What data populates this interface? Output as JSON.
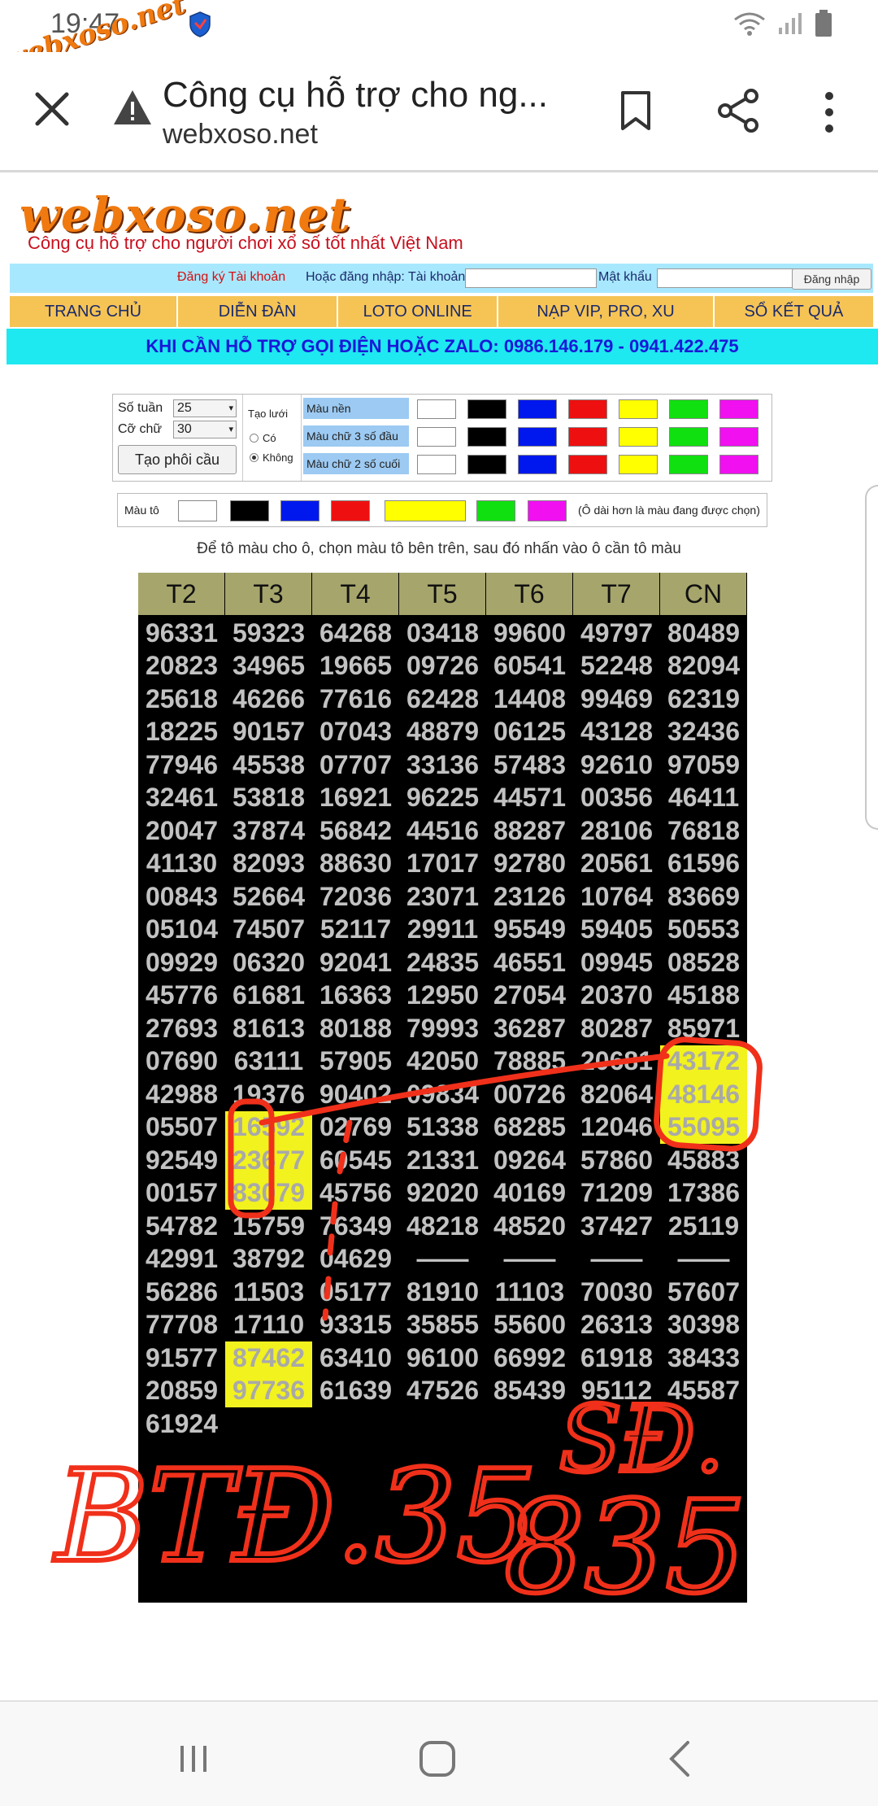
{
  "status_bar": {
    "time": "19:47",
    "watermark": "webxoso.net"
  },
  "browser": {
    "title": "Công cụ hỗ trợ cho ng...",
    "url": "webxoso.net"
  },
  "site": {
    "logo": "webxoso.net",
    "tagline": "Công cụ hỗ trợ cho người chơi xổ số tốt nhất Việt Nam"
  },
  "login": {
    "register": "Đăng ký Tài khoản",
    "or_login": "Hoặc đăng nhập: Tài khoản",
    "password_label": "Mật khẩu",
    "login_button": "Đăng nhập"
  },
  "nav": [
    "TRANG CHỦ",
    "DIỄN ĐÀN",
    "LOTO ONLINE",
    "NẠP VIP, PRO, XU",
    "SỔ KẾT QUẢ"
  ],
  "support": "KHI CẦN HỖ TRỢ GỌI ĐIỆN HOẶC ZALO: 0986.146.179 - 0941.422.475",
  "options": {
    "weeks_label": "Số tuần",
    "weeks_value": "25",
    "font_size_label": "Cỡ chữ",
    "font_size_value": "30",
    "generate_button": "Tạo phôi cầu",
    "grid_label": "Tạo lưới",
    "grid_yes": "Có",
    "grid_no": "Không",
    "bg_color_label": "Màu nền",
    "first3_color_label": "Màu chữ 3 số đầu",
    "last2_color_label": "Màu chữ 2 số cuối",
    "palette": [
      "#ffffff",
      "#000000",
      "#0018ee",
      "#ee1010",
      "#ffff00",
      "#10e010",
      "#f010f0"
    ]
  },
  "brush": {
    "label": "Màu tô",
    "note": "(Ô dài hơn là màu đang được chọn)"
  },
  "instruction": "Để tô màu cho ô, chọn màu tô bên trên, sau đó nhấn vào ô cần tô màu",
  "grid": {
    "headers": [
      "T2",
      "T3",
      "T4",
      "T5",
      "T6",
      "T7",
      "CN"
    ],
    "rows": [
      [
        "96331",
        "59323",
        "64268",
        "03418",
        "99600",
        "49797",
        "80489"
      ],
      [
        "20823",
        "34965",
        "19665",
        "09726",
        "60541",
        "52248",
        "82094"
      ],
      [
        "25618",
        "46266",
        "77616",
        "62428",
        "14408",
        "99469",
        "62319"
      ],
      [
        "18225",
        "90157",
        "07043",
        "48879",
        "06125",
        "43128",
        "32436"
      ],
      [
        "77946",
        "45538",
        "07707",
        "33136",
        "57483",
        "92610",
        "97059"
      ],
      [
        "32461",
        "53818",
        "16921",
        "96225",
        "44571",
        "00356",
        "46411"
      ],
      [
        "20047",
        "37874",
        "56842",
        "44516",
        "88287",
        "28106",
        "76818"
      ],
      [
        "41130",
        "82093",
        "88630",
        "17017",
        "92780",
        "20561",
        "61596"
      ],
      [
        "00843",
        "52664",
        "72036",
        "23071",
        "23126",
        "10764",
        "83669"
      ],
      [
        "05104",
        "74507",
        "52117",
        "29911",
        "95549",
        "59405",
        "50553"
      ],
      [
        "09929",
        "06320",
        "92041",
        "24835",
        "46551",
        "09945",
        "08528"
      ],
      [
        "45776",
        "61681",
        "16363",
        "12950",
        "27054",
        "20370",
        "45188"
      ],
      [
        "27693",
        "81613",
        "80188",
        "79993",
        "36287",
        "80287",
        "85971"
      ],
      [
        "07690",
        "63111",
        "57905",
        "42050",
        "78885",
        "20681",
        "43172"
      ],
      [
        "42988",
        "19376",
        "90402",
        "09834",
        "00726",
        "82064",
        "48146"
      ],
      [
        "05507",
        "16592",
        "02769",
        "51338",
        "68285",
        "12046",
        "55095"
      ],
      [
        "92549",
        "23677",
        "60545",
        "21331",
        "09264",
        "57860",
        "45883"
      ],
      [
        "00157",
        "83079",
        "45756",
        "92020",
        "40169",
        "71209",
        "17386"
      ],
      [
        "54782",
        "15759",
        "76349",
        "48218",
        "48520",
        "37427",
        "25119"
      ],
      [
        "42991",
        "38792",
        "04629",
        "——",
        "——",
        "——",
        "——"
      ],
      [
        "56286",
        "11503",
        "05177",
        "81910",
        "11103",
        "70030",
        "57607"
      ],
      [
        "77708",
        "17110",
        "93315",
        "35855",
        "55600",
        "26313",
        "30398"
      ],
      [
        "91577",
        "87462",
        "63410",
        "96100",
        "66992",
        "61918",
        "38433"
      ],
      [
        "20859",
        "97736",
        "61639",
        "47526",
        "85439",
        "95112",
        "45587"
      ],
      [
        "61924",
        "",
        "",
        "",
        "",
        "",
        ""
      ]
    ],
    "highlighted": [
      [
        13,
        6
      ],
      [
        14,
        6
      ],
      [
        15,
        6
      ],
      [
        15,
        1
      ],
      [
        16,
        1
      ],
      [
        17,
        1
      ],
      [
        22,
        1
      ],
      [
        23,
        1
      ]
    ]
  },
  "handwriting": {
    "left_note": "BTĐ.35",
    "right_note_line1": "SĐ.",
    "right_note_line2": "835"
  }
}
